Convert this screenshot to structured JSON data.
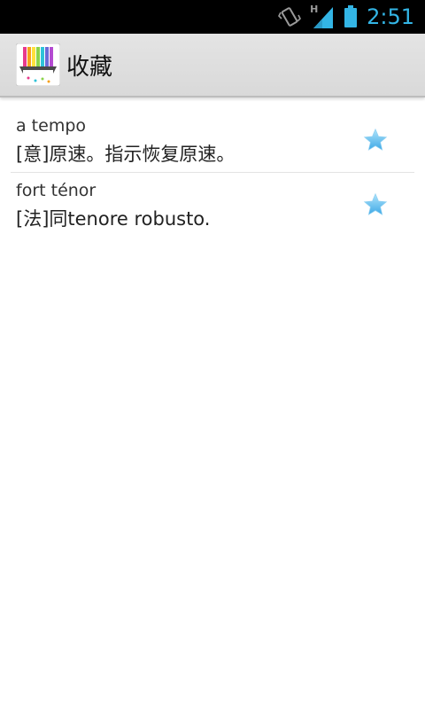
{
  "status_bar": {
    "time": "2:51",
    "network_type": "H",
    "icons": [
      "vibrate-icon",
      "signal-icon",
      "battery-icon"
    ]
  },
  "action_bar": {
    "title": "收藏",
    "app_icon": "piano-rainbow-app-icon"
  },
  "favorites": [
    {
      "word": "a tempo",
      "definition": "[意]原速。指示恢复原速。",
      "starred": true
    },
    {
      "word": "fort ténor",
      "definition": "[法]同tenore robusto.",
      "starred": true
    }
  ],
  "colors": {
    "accent": "#33b5e5",
    "star": "#6ec3ee",
    "action_bar": "#e0e0e0"
  }
}
